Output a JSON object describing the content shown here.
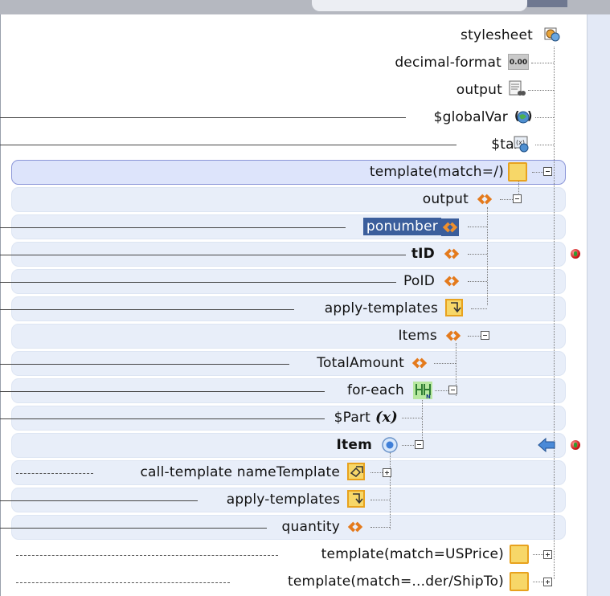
{
  "tree": {
    "rows": [
      {
        "label": "stylesheet",
        "icon": "stylesheet-icon"
      },
      {
        "label": "decimal-format",
        "icon": "decimal-format-icon",
        "icon_text": "0.00"
      },
      {
        "label": "output",
        "icon": "output-icon"
      },
      {
        "label": "$globalVar",
        "icon": "global-variable-icon"
      },
      {
        "label": "$tax",
        "icon": "tax-variable-icon"
      },
      {
        "label": "template(match=/)",
        "icon": "template-icon",
        "expander": "minus"
      },
      {
        "label": "output",
        "icon": "element-icon",
        "expander": "minus"
      },
      {
        "label": "ponumber",
        "icon": "element-icon",
        "selected": true
      },
      {
        "label": "tID",
        "icon": "element-icon",
        "bold": true
      },
      {
        "label": "PoID",
        "icon": "element-icon"
      },
      {
        "label": "apply-templates",
        "icon": "apply-templates-icon"
      },
      {
        "label": "Items",
        "icon": "element-icon",
        "expander": "minus"
      },
      {
        "label": "TotalAmount",
        "icon": "element-icon"
      },
      {
        "label": "for-each",
        "icon": "for-each-icon",
        "expander": "minus"
      },
      {
        "label": "$Part",
        "icon": "variable-x-icon",
        "icon_text": "(x)"
      },
      {
        "label": "Item",
        "icon": "context-node-icon",
        "bold": true,
        "expander": "minus"
      },
      {
        "label": "call-template nameTemplate",
        "icon": "call-template-icon",
        "expander": "plus"
      },
      {
        "label": "apply-templates",
        "icon": "apply-templates-icon"
      },
      {
        "label": "quantity",
        "icon": "element-icon"
      },
      {
        "label": "template(match=USPrice)",
        "icon": "template-icon",
        "expander": "plus"
      },
      {
        "label": "template(match=...der/ShipTo)",
        "icon": "template-icon",
        "expander": "plus"
      }
    ]
  },
  "status": {
    "tID_marker": "green-check-icon",
    "item_arrow": "blue-left-arrow-icon",
    "item_marker": "green-check-icon"
  },
  "colors": {
    "band": "#e8eef9",
    "selection": "#3b5e9c",
    "element_icon": "#e07a1e",
    "template_icon": "#f5c94a"
  }
}
